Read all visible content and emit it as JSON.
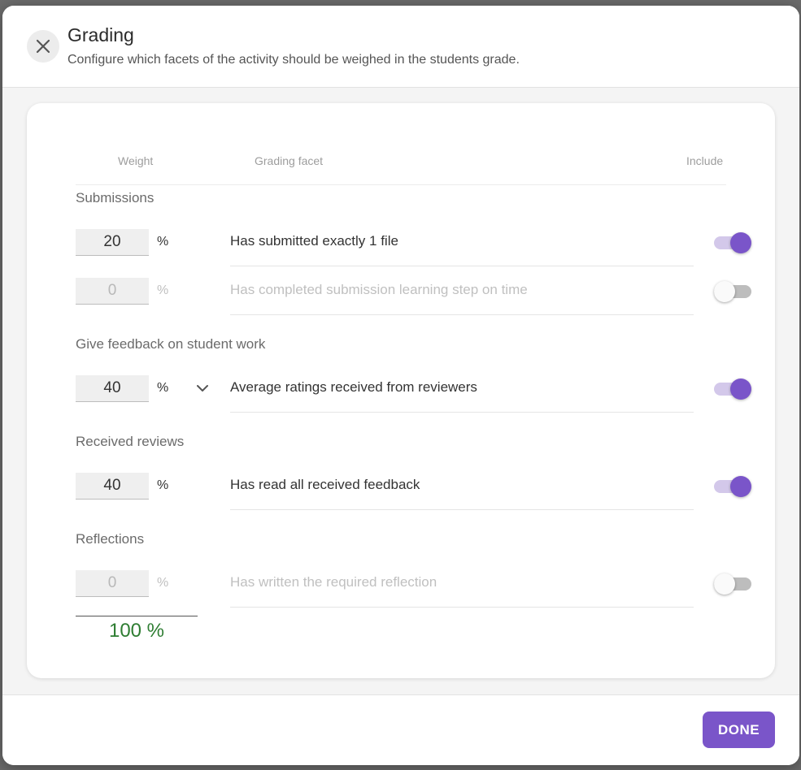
{
  "dialog": {
    "title": "Grading",
    "subtitle": "Configure which facets of the activity should be weighed in the students grade.",
    "close_icon": "close-icon"
  },
  "columns": {
    "weight": "Weight",
    "facet": "Grading facet",
    "include": "Include"
  },
  "sections": [
    {
      "title": "Submissions"
    },
    {
      "title": "Give feedback on student work"
    },
    {
      "title": "Received reviews"
    },
    {
      "title": "Reflections"
    }
  ],
  "rows": [
    {
      "weight": "20",
      "unit": "%",
      "facet": "Has submitted exactly 1 file",
      "included": true
    },
    {
      "weight": "0",
      "unit": "%",
      "facet": "Has completed submission learning step on time",
      "included": false
    },
    {
      "weight": "40",
      "unit": "%",
      "facet": "Average ratings received from reviewers",
      "included": true,
      "expand_icon": "chevron-down-icon"
    },
    {
      "weight": "40",
      "unit": "%",
      "facet": "Has read all received feedback",
      "included": true
    },
    {
      "weight": "0",
      "unit": "%",
      "facet": "Has written the required reflection",
      "included": false
    }
  ],
  "total": "100 %",
  "footer": {
    "done_label": "DONE"
  },
  "colors": {
    "accent": "#7a55c9",
    "accent_light": "#d3c8ea",
    "total": "#2e7d32"
  }
}
